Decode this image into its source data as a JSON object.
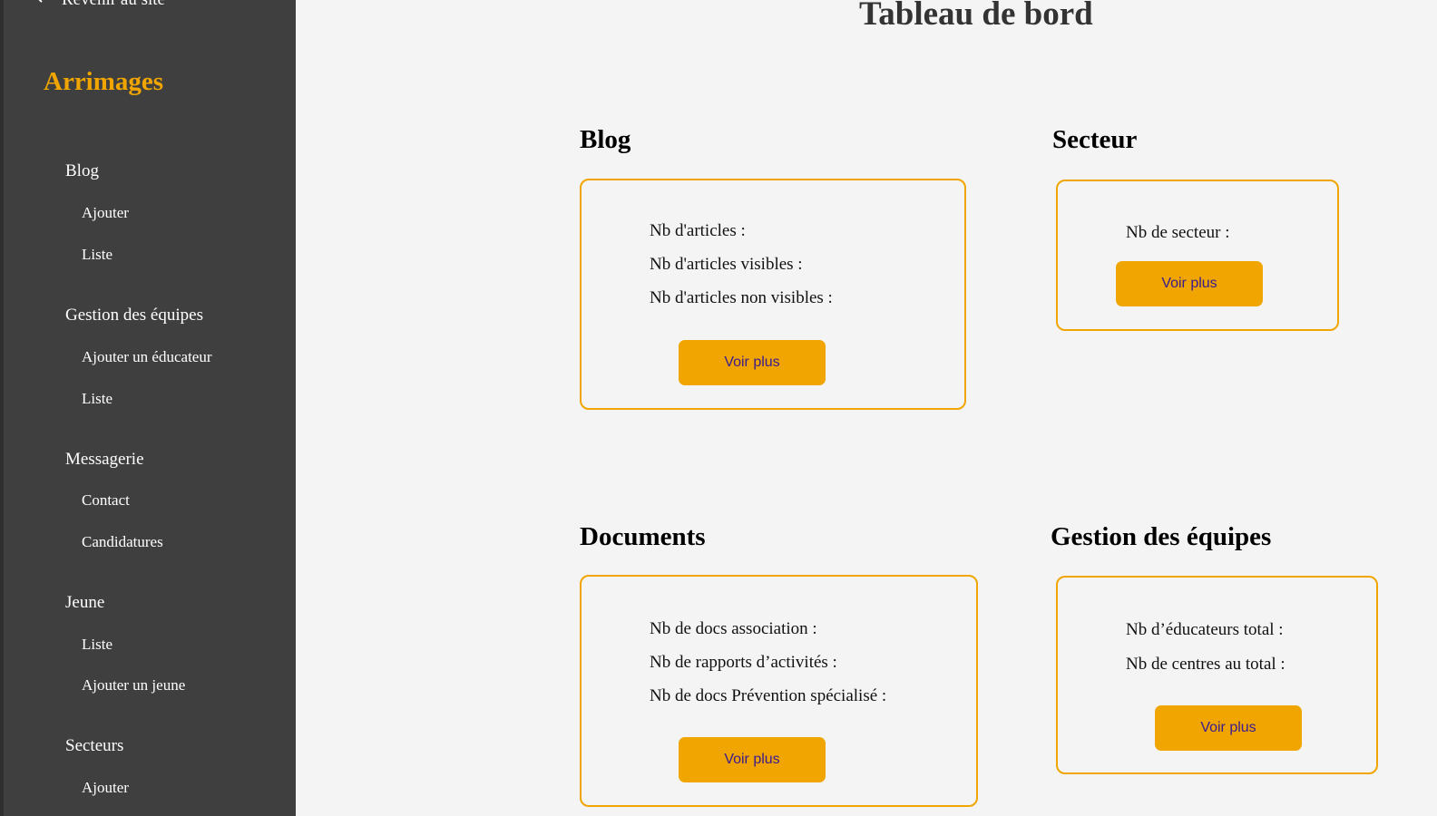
{
  "sidebar": {
    "back_icon": "back-arrow-icon",
    "back_label": "Revenir au site",
    "brand": "Arrimages",
    "brand_color": "#f0a500",
    "groups": [
      {
        "label": "Blog",
        "items": [
          "Ajouter",
          "Liste"
        ]
      },
      {
        "label": "Gestion des équipes",
        "items": [
          "Ajouter un éducateur",
          "Liste"
        ]
      },
      {
        "label": "Messagerie",
        "items": [
          "Contact",
          "Candidatures"
        ]
      },
      {
        "label": "Jeune",
        "items": [
          "Liste",
          "Ajouter un jeune"
        ]
      },
      {
        "label": "Secteurs",
        "items": [
          "Ajouter"
        ]
      }
    ]
  },
  "main": {
    "title": "Tableau de bord",
    "sections": {
      "blog": {
        "title": "Blog",
        "stats": [
          "Nb d'articles :",
          "Nb d'articles visibles :",
          "Nb d'articles non visibles :"
        ],
        "button": "Voir plus"
      },
      "secteur": {
        "title": "Secteur",
        "stats": [
          "Nb de secteur :"
        ],
        "button": "Voir plus"
      },
      "documents": {
        "title": "Documents",
        "stats": [
          "Nb de docs association :",
          "Nb de rapports d’activités :",
          "Nb de docs Prévention spécialisé :"
        ],
        "button": "Voir plus"
      },
      "equipes": {
        "title": "Gestion des équipes",
        "stats": [
          "Nb d’éducateurs total :",
          "Nb de centres au total :"
        ],
        "button": "Voir plus"
      }
    }
  },
  "colors": {
    "accent": "#f0a500",
    "sidebar_bg": "#3f3f3f",
    "page_bg": "#f4f4f4",
    "button_text": "#3a1c8e"
  }
}
